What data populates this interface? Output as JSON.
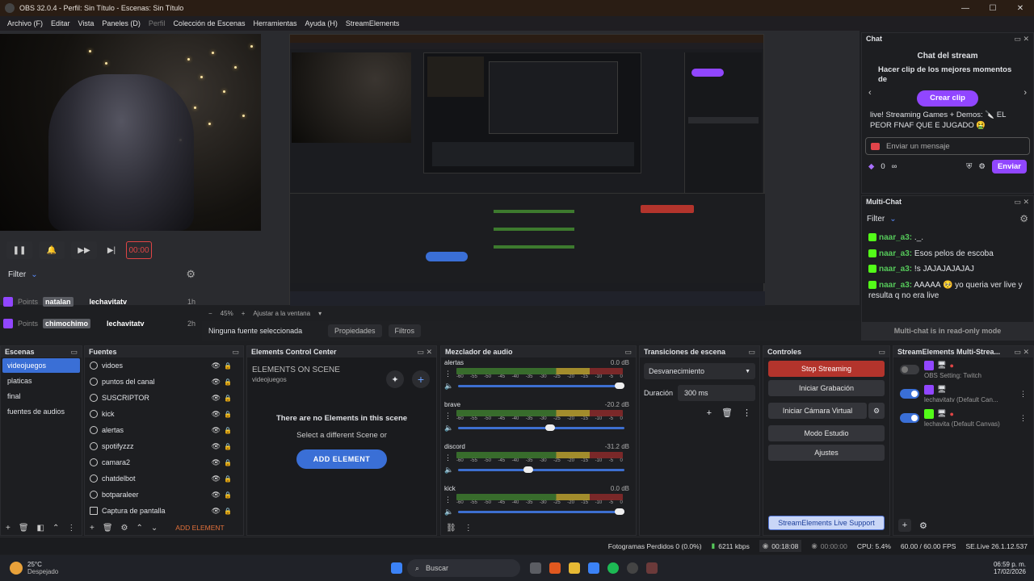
{
  "window": {
    "title": "OBS 32.0.4 - Perfil: Sin Título - Escenas: Sin Título",
    "controls": [
      "—",
      "☐",
      "✕"
    ]
  },
  "menu": [
    "Archivo (F)",
    "Editar",
    "Vista",
    "Paneles (D)",
    "Perfil",
    "Colección de Escenas",
    "Herramientas",
    "Ayuda (H)",
    "StreamElements"
  ],
  "media": {
    "pause": "❚❚",
    "bell": "🔔",
    "ff": "▶▶",
    "next": "▶|",
    "record_time": "00:00"
  },
  "filter": {
    "label": "Filter",
    "chevron": "⌄",
    "gear": "⚙"
  },
  "points": [
    {
      "label": "Points",
      "user": "natalan",
      "name": "lechavitatv",
      "time": "1h"
    },
    {
      "label": "Points",
      "user": "chimochimo",
      "name": "lechavitatv",
      "time": "2h"
    }
  ],
  "zoom": {
    "minus": "−",
    "value": "45%",
    "plus": "+",
    "fit": "Ajustar a la ventana",
    "chevron": "▾"
  },
  "source_bar": {
    "none": "Ninguna fuente seleccionada",
    "props": "Propiedades",
    "filters": "Filtros"
  },
  "chat": {
    "title": "Chat",
    "header": "Chat del stream",
    "clip_prompt": "Hacer clip de los mejores momentos de",
    "clip_button": "Crear clip",
    "stream_title": "live! Streaming Games + Demos: 🔪 EL PEOR FNAF QUE E JUGADO 🤮",
    "input_placeholder": "Enviar un mensaje",
    "points": "0",
    "infinity": "∞",
    "send": "Enviar"
  },
  "multichat": {
    "title": "Multi-Chat",
    "filter": "Filter",
    "messages": [
      {
        "user": "naar_a3:",
        "text": " ._."
      },
      {
        "user": "naar_a3:",
        "text": " Esos pelos de escoba"
      },
      {
        "user": "naar_a3:",
        "text": " !s JAJAJAJAJAJ"
      },
      {
        "user": "naar_a3:",
        "text": " AAAAA 🥺 yo queria ver live y resulta q no era live"
      }
    ],
    "footer": "Multi-chat is in read-only mode"
  },
  "scenes": {
    "title": "Escenas",
    "items": [
      "videojuegos",
      "platicas",
      "final",
      "fuentes de audios"
    ]
  },
  "sources": {
    "title": "Fuentes",
    "items": [
      "vidoes",
      "puntos del canal",
      "SUSCRIPTOR",
      "kick",
      "alertas",
      "spotifyzzz",
      "camara2",
      "chatdelbot",
      "botparaleer",
      "Captura de pantalla"
    ],
    "add_element": "ADD ELEMENT"
  },
  "elements": {
    "title": "Elements Control Center",
    "on_scene": "ELEMENTS ON SCENE",
    "scene": "videojuegos",
    "empty": "There are no Elements in this scene",
    "hint": "Select a different Scene or",
    "button": "ADD ELEMENT"
  },
  "mixer": {
    "title": "Mezclador de audio",
    "scale": [
      "-60",
      "-55",
      "-50",
      "-45",
      "-40",
      "-35",
      "-30",
      "-25",
      "-20",
      "-15",
      "-10",
      "-5",
      "0"
    ],
    "channels": [
      {
        "name": "alertas",
        "db": "0.0 dB",
        "level": 1.0
      },
      {
        "name": "brave",
        "db": "-20.2 dB",
        "level": 0.58
      },
      {
        "name": "discord",
        "db": "-31.2 dB",
        "level": 0.45
      },
      {
        "name": "kick",
        "db": "0.0 dB",
        "level": 1.0
      }
    ]
  },
  "transitions": {
    "title": "Transiciones de escena",
    "selected": "Desvanecimiento",
    "duration_label": "Duración",
    "duration": "300 ms"
  },
  "controls": {
    "title": "Controles",
    "buttons": [
      "Stop Streaming",
      "Iniciar Grabación",
      "Iniciar Cámara Virtual",
      "Modo Estudio",
      "Ajustes"
    ],
    "support": "StreamElements Live Support"
  },
  "multistream": {
    "title": "StreamElements Multi-Strea...",
    "items": [
      {
        "label": "OBS Setting: Twitch",
        "on": false
      },
      {
        "label": "lechavitatv (Default Can...",
        "on": true
      },
      {
        "label": "lechavita (Default Canvas)",
        "on": true
      }
    ]
  },
  "status": {
    "dropped": "Fotogramas Perdidos 0 (0.0%)",
    "kbps": "6211 kbps",
    "stream_time": "00:18:08",
    "rec_time": "00:00:00",
    "cpu": "CPU: 5.4%",
    "fps": "60.00 / 60.00 FPS",
    "version": "SE.Live 26.1.12.537"
  },
  "taskbar": {
    "temp": "25°C",
    "weather": "Despejado",
    "search": "Buscar",
    "time": "06:59 p. m.",
    "date": "17/02/2026"
  },
  "colors": {
    "accent": "#3a6fd6",
    "stop": "#b3342c",
    "twitch": "#9146ff",
    "kick": "#53fc18"
  }
}
